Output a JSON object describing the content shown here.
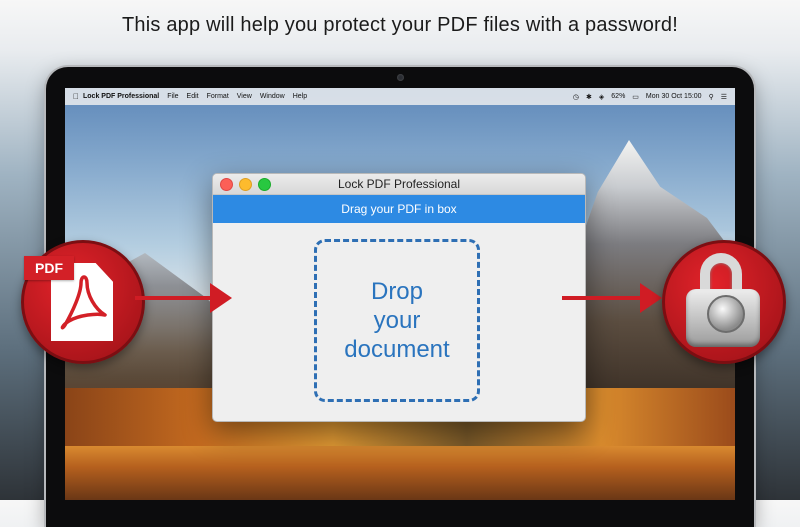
{
  "headline": "This app will help you protect your PDF files with a password!",
  "menubar": {
    "apple_icon": "apple-icon",
    "app_name": "Lock PDF Professional",
    "items": [
      "File",
      "Edit",
      "Format",
      "View",
      "Window",
      "Help"
    ],
    "battery": "62%",
    "clock": "Mon 30 Oct  15:00"
  },
  "window": {
    "title": "Lock PDF Professional",
    "instruction": "Drag your PDF in box",
    "dropzone_text": "Drop\nyour\ndocument"
  },
  "badges": {
    "pdf_label": "PDF",
    "pdf_icon": "acrobat-icon",
    "lock_icon": "padlock-icon"
  },
  "colors": {
    "accent_blue": "#2d8ae3",
    "brand_red": "#d01c24"
  }
}
